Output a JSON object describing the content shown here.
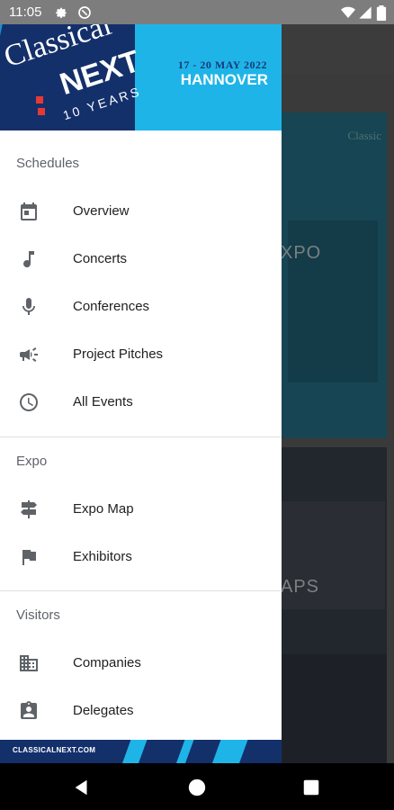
{
  "status_bar": {
    "time": "11:05",
    "icons": [
      "settings-icon",
      "sync-icon",
      "wifi-icon",
      "signal-icon",
      "battery-icon"
    ]
  },
  "background": {
    "card_expo_label": "XPO",
    "card_maps_label": "APS",
    "card_expo_watermark": "Classic"
  },
  "drawer": {
    "header": {
      "logo_word1": "Classical",
      "logo_word2": "NEXT",
      "logo_years": "10 YEARS",
      "dates": "17 - 20 MAY 2022",
      "city": "HANNOVER"
    },
    "sections": [
      {
        "title": "Schedules",
        "items": [
          {
            "label": "Overview",
            "icon": "calendar-icon"
          },
          {
            "label": "Concerts",
            "icon": "music-note-icon"
          },
          {
            "label": "Conferences",
            "icon": "microphone-icon"
          },
          {
            "label": "Project Pitches",
            "icon": "megaphone-icon"
          },
          {
            "label": "All Events",
            "icon": "clock-icon"
          }
        ]
      },
      {
        "title": "Expo",
        "items": [
          {
            "label": "Expo Map",
            "icon": "signpost-icon"
          },
          {
            "label": "Exhibitors",
            "icon": "flag-icon"
          }
        ]
      },
      {
        "title": "Visitors",
        "items": [
          {
            "label": "Companies",
            "icon": "building-icon"
          },
          {
            "label": "Delegates",
            "icon": "badge-icon"
          }
        ]
      }
    ],
    "footer_text": "CLASSICALNEXT.COM"
  },
  "colors": {
    "header_navy": "#14306b",
    "header_cyan": "#1fb4e8",
    "accent_red": "#e53935",
    "icon_grey": "#5f6368"
  },
  "nav_bar": [
    "back-icon",
    "home-icon",
    "recents-icon"
  ]
}
